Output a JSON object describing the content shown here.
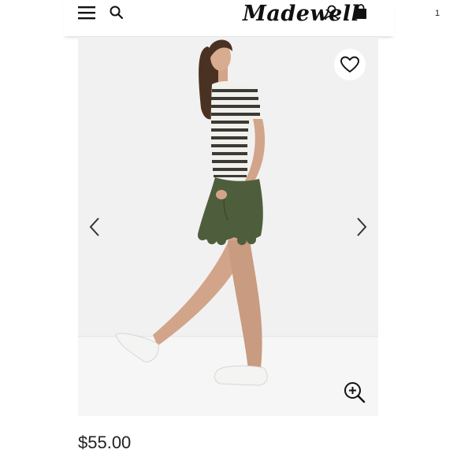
{
  "header": {
    "brand": "Madewell",
    "cart_count": "1",
    "icons": {
      "menu": "hamburger-menu-icon",
      "search": "search-icon",
      "account": "user-icon",
      "cart": "shopping-bag-icon"
    }
  },
  "gallery": {
    "image_subject": "model wearing striped tee and green scalloped shorts",
    "icons": {
      "prev": "chevron-left-icon",
      "next": "chevron-right-icon",
      "favorite": "heart-icon",
      "zoom": "zoom-in-icon"
    }
  },
  "product": {
    "price": "$55.00"
  },
  "colors": {
    "shorts": "#4e5e3c",
    "skin": "#d2a489",
    "text": "#222222"
  }
}
